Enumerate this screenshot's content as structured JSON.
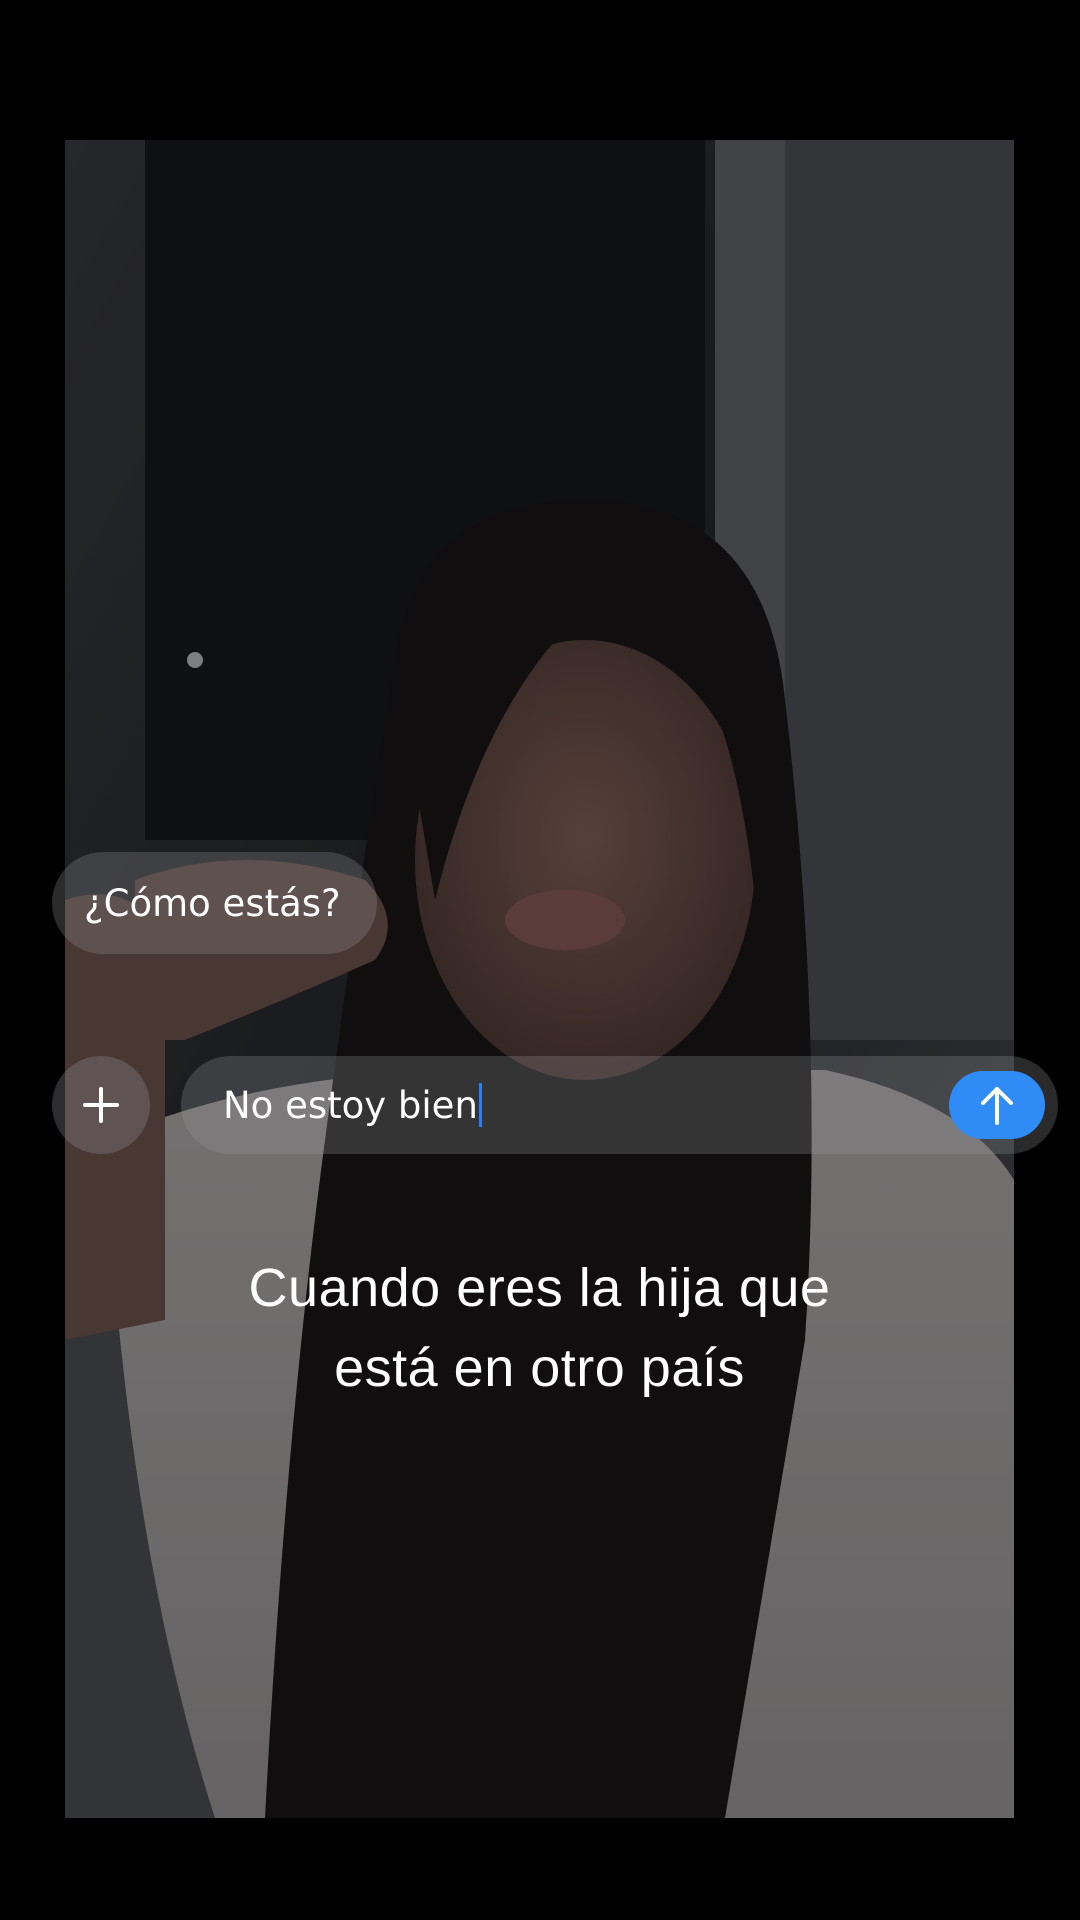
{
  "chat": {
    "received_message": "¿Cómo estás?",
    "input_value": "No estoy bien"
  },
  "caption": {
    "line1": "Cuando eres la hija que",
    "line2": "está en otro país"
  },
  "icons": {
    "add": "plus-icon",
    "send": "arrow-up-icon"
  },
  "colors": {
    "send_button": "#2f8cf6",
    "caret": "#2f7df6",
    "background": "#000000"
  }
}
